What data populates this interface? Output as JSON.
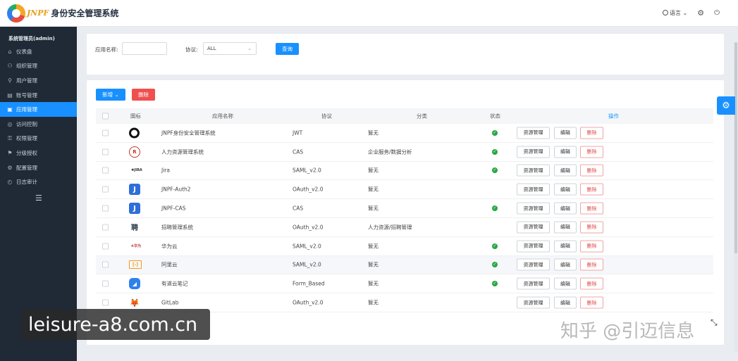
{
  "header": {
    "brand": "JNPF",
    "title": "身份安全管理系统",
    "language": "语言"
  },
  "sidebar": {
    "user": "系统管理员(admin)",
    "items": [
      {
        "label": "仪表盘",
        "icon": "⌂",
        "active": false
      },
      {
        "label": "组织管理",
        "icon": "⚇",
        "active": false
      },
      {
        "label": "用户管理",
        "icon": "⚲",
        "active": false
      },
      {
        "label": "账号管理",
        "icon": "▤",
        "active": false
      },
      {
        "label": "应用管理",
        "icon": "▣",
        "active": true
      },
      {
        "label": "访问控制",
        "icon": "◎",
        "active": false
      },
      {
        "label": "权限管理",
        "icon": "⚿",
        "active": false
      },
      {
        "label": "分级授权",
        "icon": "⚑",
        "active": false
      },
      {
        "label": "配置管理",
        "icon": "⚙",
        "active": false
      },
      {
        "label": "日志审计",
        "icon": "◴",
        "active": false
      }
    ]
  },
  "search": {
    "app_name_label": "应用名称:",
    "protocol_label": "协议:",
    "protocol_value": "ALL",
    "query_button": "查询"
  },
  "toolbar": {
    "add_button": "新增",
    "delete_button": "删除"
  },
  "table": {
    "columns": {
      "icon": "图标",
      "name": "应用名称",
      "protocol": "协议",
      "category": "分类",
      "status": "状态",
      "actions": "操作"
    },
    "action_labels": {
      "resource": "资源管理",
      "edit": "编辑",
      "delete": "删除"
    },
    "rows": [
      {
        "icon": "circle-c-logo",
        "glyph": "",
        "name": "JNPF身份安全管理系统",
        "protocol": "JWT",
        "category": "暂无",
        "status_ok": true
      },
      {
        "icon": "hr-logo",
        "glyph": "R",
        "name": "人力资源管理系统",
        "protocol": "CAS",
        "category": "企业服务/数据分析",
        "status_ok": true
      },
      {
        "icon": "jira-logo",
        "glyph": "✱JIRA",
        "name": "Jira",
        "protocol": "SAML_v2.0",
        "category": "暂无",
        "status_ok": true
      },
      {
        "icon": "jnpf-j-logo",
        "glyph": "J",
        "name": "JNPF-Auth2",
        "protocol": "OAuth_v2.0",
        "category": "暂无",
        "status_ok": false
      },
      {
        "icon": "jnpf-j-logo",
        "glyph": "J",
        "name": "JNPF-CAS",
        "protocol": "CAS",
        "category": "暂无",
        "status_ok": true
      },
      {
        "icon": "recruit-logo",
        "glyph": "聘",
        "name": "招聘管理系统",
        "protocol": "OAuth_v2.0",
        "category": "人力资源/招聘管理",
        "status_ok": false
      },
      {
        "icon": "huawei-cloud-logo",
        "glyph": "❀华为",
        "name": "华为云",
        "protocol": "SAML_v2.0",
        "category": "暂无",
        "status_ok": true
      },
      {
        "icon": "aliyun-logo",
        "glyph": "[-]",
        "name": "阿里云",
        "protocol": "SAML_v2.0",
        "category": "暂无",
        "status_ok": true
      },
      {
        "icon": "youdao-note-logo",
        "glyph": "◢",
        "name": "有道云笔记",
        "protocol": "Form_Based",
        "category": "暂无",
        "status_ok": true
      },
      {
        "icon": "gitlab-logo",
        "glyph": "🦊",
        "name": "GitLab",
        "protocol": "OAuth_v2.0",
        "category": "暂无",
        "status_ok": false
      }
    ]
  },
  "watermarks": {
    "left": "leisure-a8.com.cn",
    "right": "知乎 @引迈信息"
  }
}
